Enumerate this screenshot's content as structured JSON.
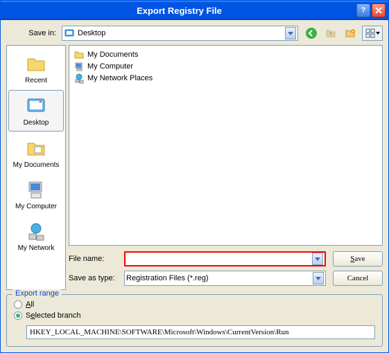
{
  "window": {
    "title": "Export Registry File"
  },
  "toolbar": {
    "savein_label": "Save in:",
    "savein_value": "Desktop"
  },
  "places": [
    {
      "label": "Recent",
      "name": "recent"
    },
    {
      "label": "Desktop",
      "name": "desktop"
    },
    {
      "label": "My Documents",
      "name": "my-documents"
    },
    {
      "label": "My Computer",
      "name": "my-computer"
    },
    {
      "label": "My Network",
      "name": "my-network"
    }
  ],
  "filelist": [
    {
      "label": "My Documents",
      "icon": "folder"
    },
    {
      "label": "My Computer",
      "icon": "computer"
    },
    {
      "label": "My Network Places",
      "icon": "network"
    }
  ],
  "fields": {
    "filename_label": "File name:",
    "filename_value": "",
    "filetype_label": "Save as type:",
    "filetype_value": "Registration Files (*.reg)",
    "save_button": "Save",
    "cancel_button": "Cancel"
  },
  "export_range": {
    "title": "Export range",
    "all_label": "All",
    "selected_label": "Selected branch",
    "branch_value": "HKEY_LOCAL_MACHINE\\SOFTWARE\\Microsoft\\Windows\\CurrentVersion\\Run",
    "selected": "selected"
  }
}
